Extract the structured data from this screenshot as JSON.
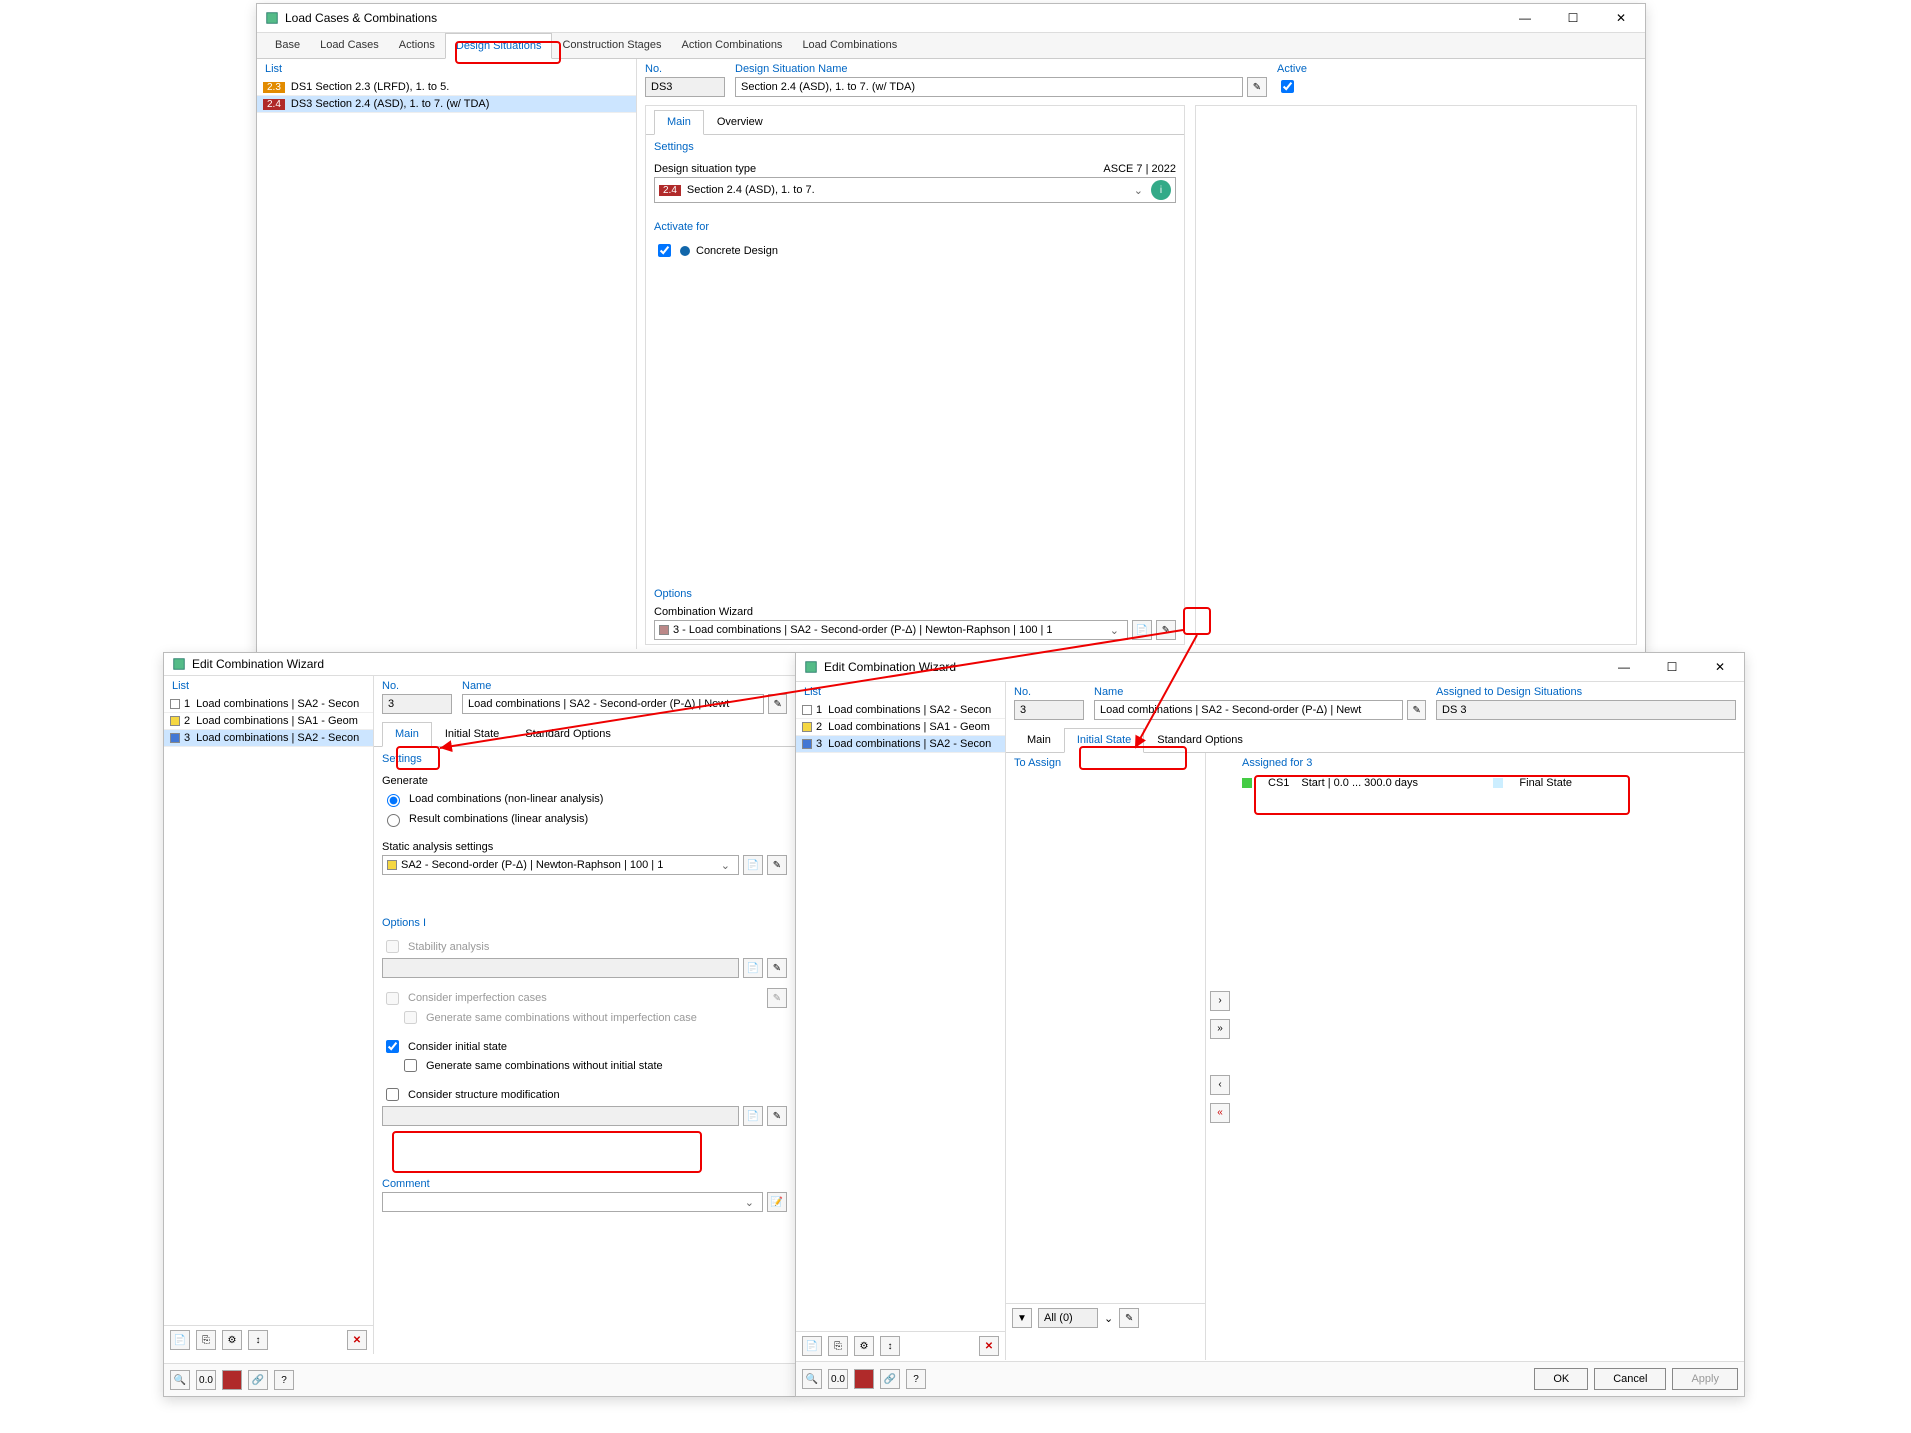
{
  "main_window": {
    "title": "Load Cases & Combinations",
    "tabs": [
      "Base",
      "Load Cases",
      "Actions",
      "Design Situations",
      "Construction Stages",
      "Action Combinations",
      "Load Combinations"
    ],
    "active_tab": "Design Situations",
    "list_header": "List",
    "list_items": [
      {
        "badge": "2.3",
        "badge_color": "#e28b00",
        "text": "DS1  Section 2.3 (LRFD), 1. to 5."
      },
      {
        "badge": "2.4",
        "badge_color": "#b02a2a",
        "text": "DS3  Section 2.4 (ASD), 1. to 7. (w/ TDA)"
      }
    ],
    "no_label": "No.",
    "no_value": "DS3",
    "name_label": "Design Situation Name",
    "name_value": "Section 2.4 (ASD), 1. to 7. (w/ TDA)",
    "active_label": "Active",
    "subtabs": [
      "Main",
      "Overview"
    ],
    "settings_header": "Settings",
    "design_sit_type_label": "Design situation type",
    "design_sit_standard": "ASCE 7 | 2022",
    "design_sit_badge": "2.4",
    "design_sit_value": "Section 2.4 (ASD), 1. to 7.",
    "activate_for_header": "Activate for",
    "concrete_design": "Concrete Design",
    "options_header": "Options",
    "combo_wizard_label": "Combination Wizard",
    "combo_wizard_value": "3 - Load combinations | SA2 - Second-order (P-Δ) | Newton-Raphson | 100 | 1"
  },
  "left_dialog": {
    "title": "Edit Combination Wizard",
    "list_header": "List",
    "list_items": [
      {
        "num": "1",
        "text": "Load combinations | SA2 - Secon",
        "swatch": "#fff"
      },
      {
        "num": "2",
        "text": "Load combinations | SA1 - Geom",
        "swatch": "#f5d742"
      },
      {
        "num": "3",
        "text": "Load combinations | SA2 - Secon",
        "swatch": "#4277d4"
      }
    ],
    "no_label": "No.",
    "no_value": "3",
    "name_label": "Name",
    "name_value": "Load combinations | SA2 - Second-order (P-Δ) | Newt",
    "subtabs": [
      "Main",
      "Initial State",
      "Standard Options"
    ],
    "active_subtab": "Main",
    "settings_header": "Settings",
    "generate_header": "Generate",
    "radio_nonlinear": "Load combinations (non-linear analysis)",
    "radio_linear": "Result combinations (linear analysis)",
    "static_label": "Static analysis settings",
    "static_value": "SA2 - Second-order (P-Δ) | Newton-Raphson | 100 | 1",
    "options1_header": "Options I",
    "stability": "Stability analysis",
    "imperfection": "Consider imperfection cases",
    "imperfection_sub": "Generate same combinations without imperfection case",
    "initial_state": "Consider initial state",
    "initial_state_sub": "Generate same combinations without initial state",
    "structure_mod": "Consider structure modification",
    "comment_header": "Comment"
  },
  "right_dialog": {
    "title": "Edit Combination Wizard",
    "list_header": "List",
    "list_items": [
      {
        "num": "1",
        "text": "Load combinations | SA2 - Secon",
        "swatch": "#fff"
      },
      {
        "num": "2",
        "text": "Load combinations | SA1 - Geom",
        "swatch": "#f5d742"
      },
      {
        "num": "3",
        "text": "Load combinations | SA2 - Secon",
        "swatch": "#4277d4"
      }
    ],
    "no_label": "No.",
    "no_value": "3",
    "name_label": "Name",
    "name_value": "Load combinations | SA2 - Second-order (P-Δ) | Newt",
    "subtabs": [
      "Main",
      "Initial State",
      "Standard Options"
    ],
    "active_subtab": "Initial State",
    "assigned_ds_label": "Assigned to Design Situations",
    "assigned_ds_value": "DS 3",
    "to_assign_header": "To Assign",
    "assigned_for_header": "Assigned for 3",
    "assigned_item_name": "CS1",
    "assigned_item_range": "Start | 0.0 ... 300.0 days",
    "assigned_item_final": "Final State",
    "filter_all": "All (0)",
    "ok": "OK",
    "cancel": "Cancel",
    "apply": "Apply"
  }
}
